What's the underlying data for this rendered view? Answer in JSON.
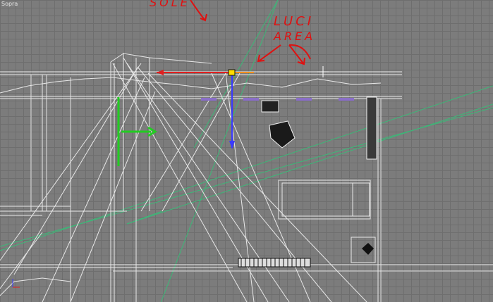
{
  "viewport": {
    "label": "Sopra"
  },
  "annotations": {
    "sole": "SOLE",
    "luci": "LUCI",
    "area": "AREA"
  },
  "colors": {
    "background": "#7c7c7c",
    "grid": "#6e6e6e",
    "wireframe": "#e8e8e8",
    "annotation": "#e01010",
    "x_axis": "#e02020",
    "y_axis": "#3a3aff",
    "light_cone": "#3cb878",
    "gizmo_green": "#22cc22"
  },
  "icons": [
    "move-gizmo-icon",
    "axis-tripod-icon",
    "light-target-icon"
  ]
}
